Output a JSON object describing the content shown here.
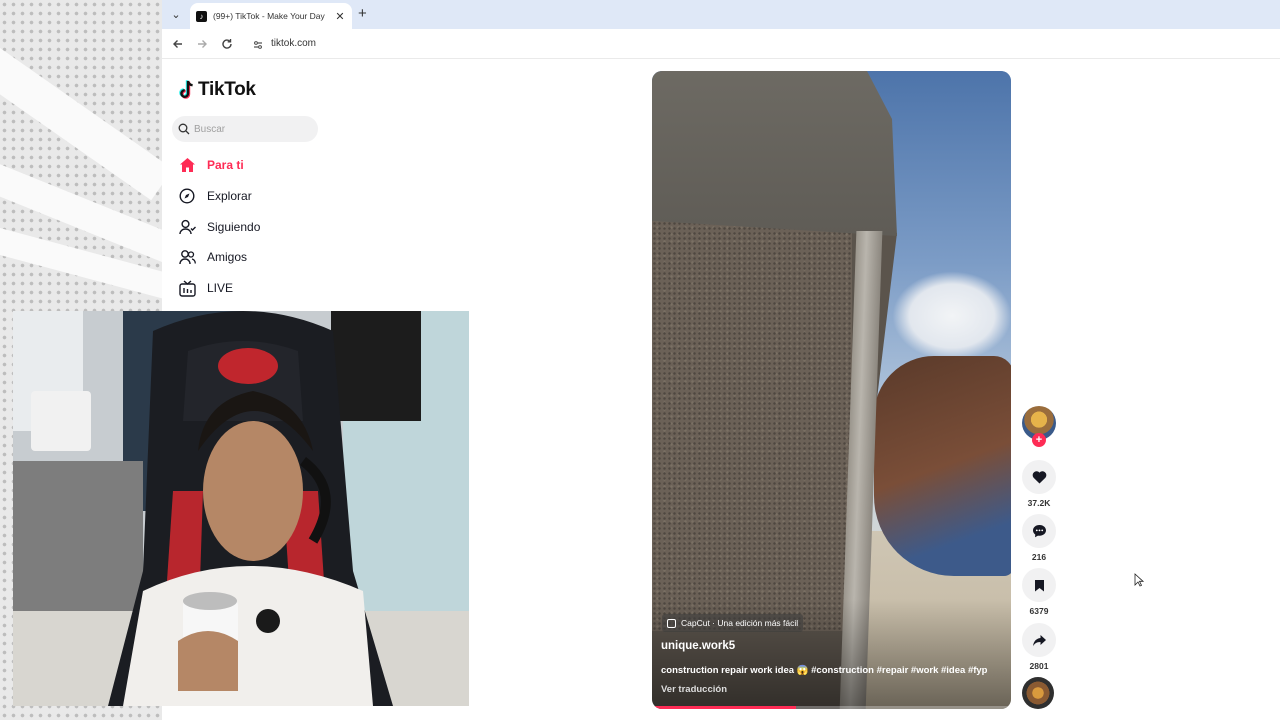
{
  "browser": {
    "tab_title": "(99+) TikTok - Make Your Day",
    "url": "tiktok.com"
  },
  "sidebar": {
    "logo_text": "TikTok",
    "search_placeholder": "Buscar",
    "items": [
      {
        "label": "Para ti",
        "icon": "home-icon",
        "active": true
      },
      {
        "label": "Explorar",
        "icon": "compass-icon",
        "active": false
      },
      {
        "label": "Siguiendo",
        "icon": "user-follow-icon",
        "active": false
      },
      {
        "label": "Amigos",
        "icon": "friends-icon",
        "active": false
      },
      {
        "label": "LIVE",
        "icon": "live-icon",
        "active": false
      }
    ]
  },
  "video": {
    "capcut_badge": "CapCut · Una edición más fácil",
    "author": "unique.work5",
    "caption": "construction repair work idea 😱 #construction #repair #work #idea #fyp",
    "translate_label": "Ver traducción",
    "progress": 0.4
  },
  "actions": {
    "likes": "37.2K",
    "comments": "216",
    "saves": "6379",
    "shares": "2801"
  },
  "colors": {
    "accent": "#fe2c55",
    "tabbar": "#dfe8f7"
  }
}
